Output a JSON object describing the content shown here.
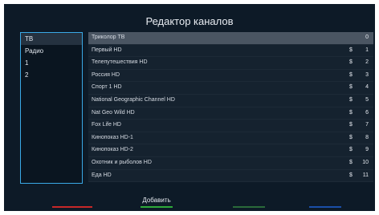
{
  "title": "Редактор каналов",
  "categories": [
    {
      "label": "ТВ",
      "selected": true
    },
    {
      "label": "Радио",
      "selected": false
    },
    {
      "label": "1",
      "selected": false
    },
    {
      "label": "2",
      "selected": false
    }
  ],
  "channels": [
    {
      "name": "Триколор ТВ",
      "paid": "",
      "number": "0",
      "selected": true
    },
    {
      "name": "Первый HD",
      "paid": "$",
      "number": "1",
      "selected": false
    },
    {
      "name": "Телепутешествия HD",
      "paid": "$",
      "number": "2",
      "selected": false
    },
    {
      "name": "Россия HD",
      "paid": "$",
      "number": "3",
      "selected": false
    },
    {
      "name": "Спорт 1 HD",
      "paid": "$",
      "number": "4",
      "selected": false
    },
    {
      "name": "National Geographic Channel HD",
      "paid": "$",
      "number": "5",
      "selected": false
    },
    {
      "name": "Nat Geo Wild HD",
      "paid": "$",
      "number": "6",
      "selected": false
    },
    {
      "name": "Fox Life HD",
      "paid": "$",
      "number": "7",
      "selected": false
    },
    {
      "name": "Кинопоказ HD-1",
      "paid": "$",
      "number": "8",
      "selected": false
    },
    {
      "name": "Кинопоказ HD-2",
      "paid": "$",
      "number": "9",
      "selected": false
    },
    {
      "name": "Охотник и рыболов HD",
      "paid": "$",
      "number": "10",
      "selected": false
    },
    {
      "name": "Еда HD",
      "paid": "$",
      "number": "11",
      "selected": false
    }
  ],
  "buttons": {
    "red": {
      "label": "",
      "color": "#c62828"
    },
    "green": {
      "label": "Добавить",
      "color": "#2eaa3a"
    },
    "yellow": {
      "label": "",
      "color": "#2a6a3a"
    },
    "blue": {
      "label": "",
      "color": "#1a4fa8"
    }
  },
  "colors": {
    "screen_bg": "#0d1a27",
    "list_bg": "#15222f",
    "focus_border": "#3aa9e6",
    "row_highlight": "#4a5562"
  }
}
